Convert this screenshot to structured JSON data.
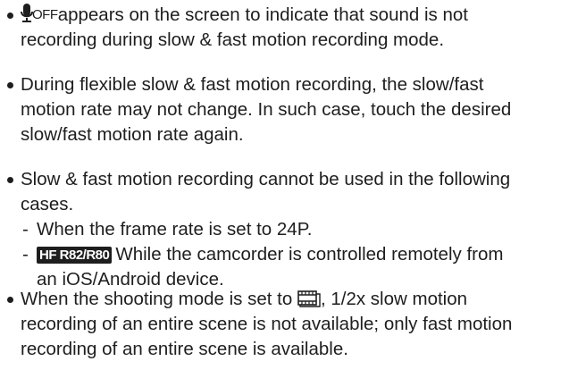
{
  "bullets": [
    {
      "icon": "mic-off-icon",
      "icon_label": "OFF",
      "line1": "appears on the screen to indicate that sound is not",
      "line2": "recording during slow & fast motion recording mode."
    },
    {
      "line1": "During flexible slow & fast motion recording, the slow/fast",
      "line2": "motion rate may not change. In such case, touch the desired",
      "line3": "slow/fast motion rate again."
    },
    {
      "line1": "Slow & fast motion recording cannot be used in the following",
      "line2": "cases.",
      "sub_items": [
        {
          "dash": "-",
          "text": "When the frame rate is set to 24P."
        },
        {
          "dash": "-",
          "badge": "HF R82/R80",
          "text": "While the camcorder is controlled remotely from",
          "text2": "an iOS/Android device."
        }
      ]
    },
    {
      "line1_pre": "When the shooting mode is set to",
      "icon": "movie-mode-icon",
      "line1_post": ", 1/2x slow motion",
      "line2": "recording of an entire scene is not available; only fast motion",
      "line3": "recording of an entire scene is available."
    }
  ]
}
